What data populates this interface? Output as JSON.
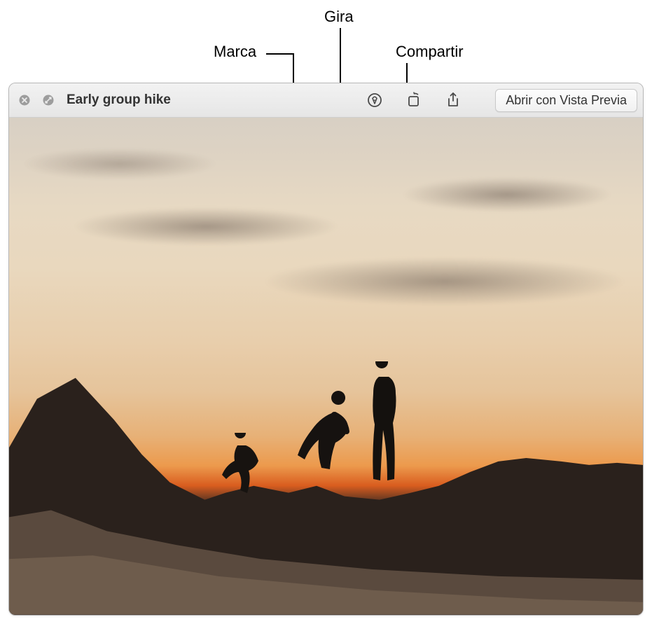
{
  "callouts": {
    "markup": "Marca",
    "rotate": "Gira",
    "share": "Compartir"
  },
  "titlebar": {
    "title": "Early group hike",
    "open_button": "Abrir con Vista Previa"
  }
}
